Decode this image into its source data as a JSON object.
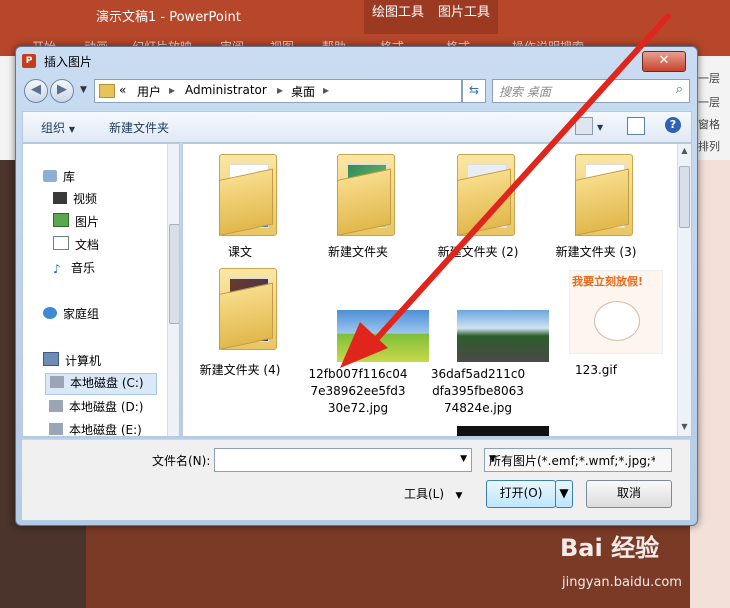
{
  "app": {
    "title": "演示文稿1  -  PowerPoint",
    "context_tabs": [
      "绘图工具",
      "图片工具"
    ],
    "ribbon_tabs": [
      "开始",
      "动画",
      "幻灯片放映",
      "审阅",
      "视图",
      "帮助",
      "格式",
      "格式",
      "操作说明搜索"
    ],
    "ribbon_right": [
      "上移一层",
      "下移一层",
      "选择窗格",
      "排列"
    ]
  },
  "dialog": {
    "title": "插入图片",
    "close": "✕",
    "breadcrumb": [
      "«",
      "用户",
      "Administrator",
      "桌面"
    ],
    "search_placeholder": "搜索 桌面",
    "toolbar": {
      "organize": "组织",
      "new_folder": "新建文件夹"
    },
    "nav": {
      "library": "库",
      "libs": [
        "视频",
        "图片",
        "文档",
        "音乐"
      ],
      "homegroup": "家庭组",
      "computer": "计算机",
      "drives": [
        "本地磁盘 (C:)",
        "本地磁盘 (D:)",
        "本地磁盘 (E:)"
      ]
    },
    "files": [
      {
        "name": "课文",
        "kind": "folder"
      },
      {
        "name": "新建文件夹",
        "kind": "folder"
      },
      {
        "name": "新建文件夹 (2)",
        "kind": "folder"
      },
      {
        "name": "新建文件夹 (3)",
        "kind": "folder"
      },
      {
        "name": "新建文件夹 (4)",
        "kind": "folder"
      },
      {
        "name_lines": [
          "12fb007f116c04",
          "7e38962ee5fd3",
          "30e72.jpg"
        ],
        "kind": "image-field"
      },
      {
        "name_lines": [
          "36daf5ad211c0",
          "dfa395fbe8063",
          "74824e.jpg"
        ],
        "kind": "image-road"
      },
      {
        "name": "123.gif",
        "kind": "image-cartoon",
        "banner": "我要立刻放假!"
      }
    ],
    "filename_label": "文件名(N):",
    "filename_value": "",
    "filetype_value": "所有图片(*.emf;*.wmf;*.jpg;*.jp",
    "tools_label": "工具(L)",
    "open_label": "打开(O)",
    "cancel_label": "取消"
  },
  "watermark": {
    "brand": "Bai 经验",
    "url": "jingyan.baidu.com"
  },
  "colors": {
    "ppt_red": "#b7472a",
    "dialog_blue": "#c9dcf2",
    "arrow_red": "#e0261c"
  }
}
